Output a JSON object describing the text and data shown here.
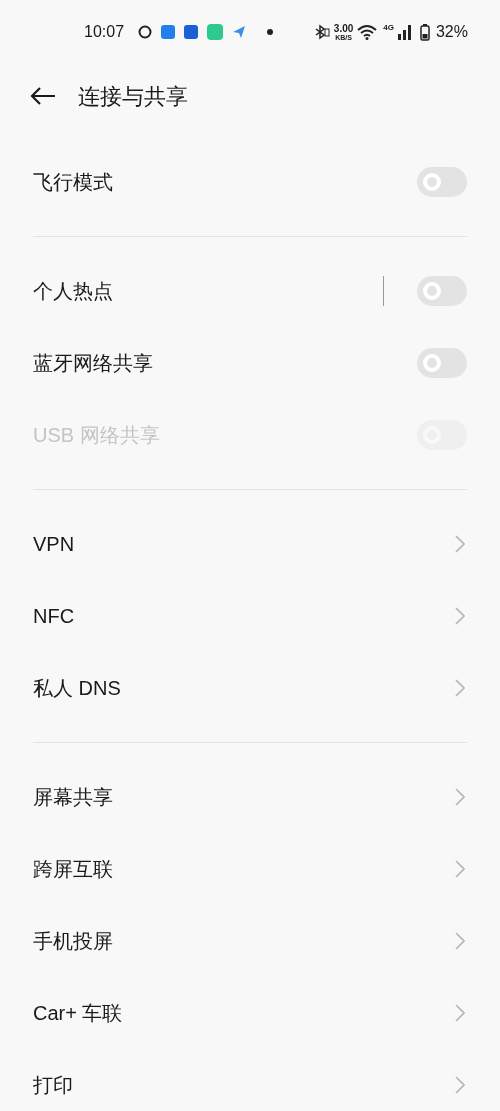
{
  "status_bar": {
    "time": "10:07",
    "net_speed": "3.00",
    "net_unit": "KB/S",
    "network": "4G",
    "battery": "32%"
  },
  "header": {
    "title": "连接与共享"
  },
  "sections": [
    {
      "items": [
        {
          "kind": "toggle",
          "label": "飞行模式",
          "on": false,
          "disabled": false,
          "divider": false
        }
      ]
    },
    {
      "items": [
        {
          "kind": "toggle",
          "label": "个人热点",
          "on": false,
          "disabled": false,
          "divider": true
        },
        {
          "kind": "toggle",
          "label": "蓝牙网络共享",
          "on": false,
          "disabled": false,
          "divider": false
        },
        {
          "kind": "toggle",
          "label": "USB 网络共享",
          "on": false,
          "disabled": true,
          "divider": false
        }
      ]
    },
    {
      "items": [
        {
          "kind": "link",
          "label": "VPN"
        },
        {
          "kind": "link",
          "label": "NFC"
        },
        {
          "kind": "link",
          "label": "私人 DNS"
        }
      ]
    },
    {
      "items": [
        {
          "kind": "link",
          "label": "屏幕共享"
        },
        {
          "kind": "link",
          "label": "跨屏互联"
        },
        {
          "kind": "link",
          "label": "手机投屏"
        },
        {
          "kind": "link",
          "label": "Car+ 车联"
        },
        {
          "kind": "link",
          "label": "打印"
        }
      ]
    }
  ]
}
